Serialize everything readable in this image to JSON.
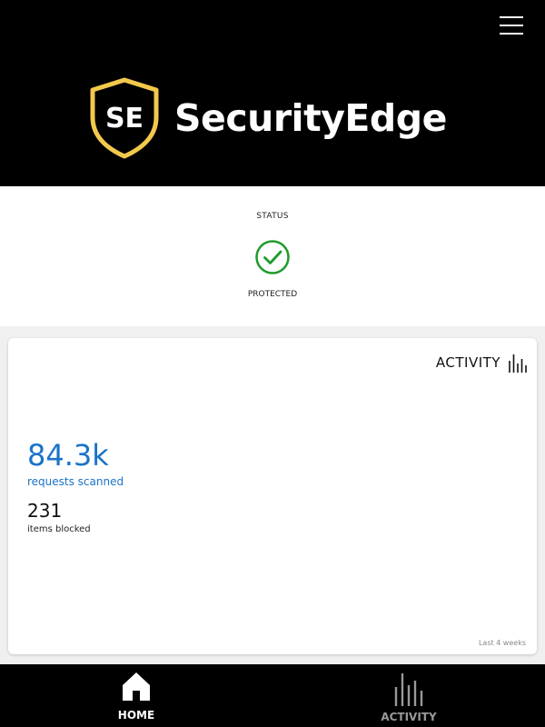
{
  "colors": {
    "header_bg": "#000000",
    "brand_gold": "#f2c94c",
    "accent_blue": "#1a73c8",
    "status_green": "#1e9b2c"
  },
  "header": {
    "logo_monogram": "SE",
    "brand_name": "SecurityEdge",
    "menu_icon": "hamburger-menu-icon"
  },
  "status": {
    "label": "STATUS",
    "icon": "check-circle-icon",
    "value": "PROTECTED"
  },
  "activity_card": {
    "title": "ACTIVITY",
    "title_icon": "activity-bars-icon",
    "primary_metric": {
      "value": "84.3k",
      "label": "requests scanned"
    },
    "secondary_metric": {
      "value": "231",
      "label": "items blocked"
    },
    "footnote": "Last 4 weeks"
  },
  "bottom_nav": {
    "items": [
      {
        "label": "HOME",
        "icon": "home-icon",
        "active": true
      },
      {
        "label": "ACTIVITY",
        "icon": "activity-bars-icon",
        "active": false
      }
    ]
  }
}
